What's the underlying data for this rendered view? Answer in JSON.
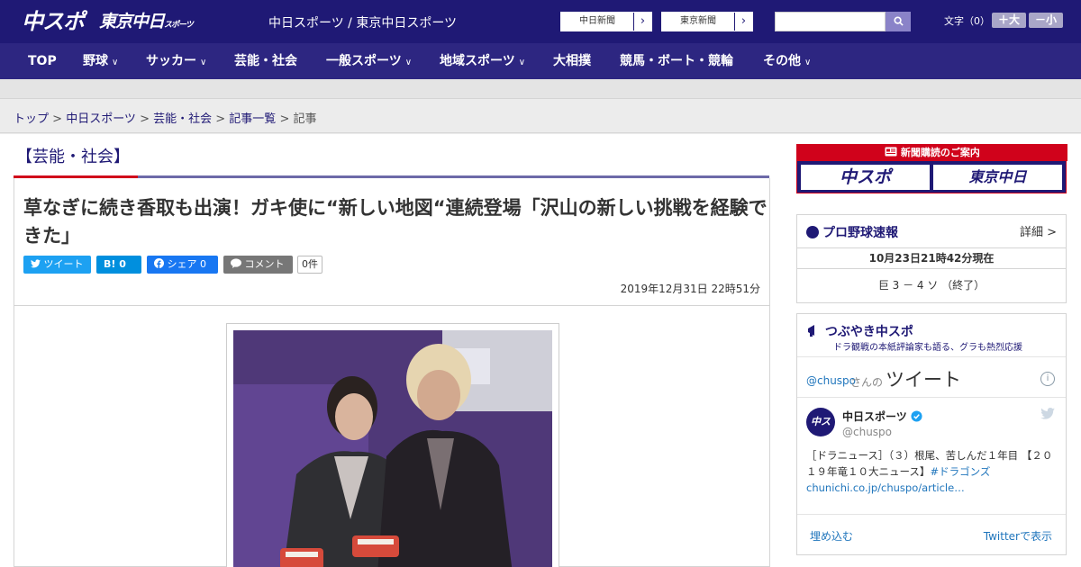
{
  "header": {
    "logo_chuspo": "中スポ",
    "logo_tokyo": "東京中日",
    "logo_tokyo_sub": "スポーツ",
    "site_title": "中日スポーツ / 東京中日スポーツ",
    "paper_links": [
      {
        "label": "中日新聞"
      },
      {
        "label": "東京新聞"
      }
    ],
    "search_placeholder": "",
    "font_size_label": "文字（0）",
    "font_plus": "＋大",
    "font_minus": "－小"
  },
  "nav": [
    {
      "label": "TOP",
      "has_menu": false
    },
    {
      "label": "野球",
      "has_menu": true
    },
    {
      "label": "サッカー",
      "has_menu": true
    },
    {
      "label": "芸能・社会",
      "has_menu": false
    },
    {
      "label": "一般スポーツ",
      "has_menu": true
    },
    {
      "label": "地域スポーツ",
      "has_menu": true
    },
    {
      "label": "大相撲",
      "has_menu": false
    },
    {
      "label": "競馬・ボート・競輪",
      "has_menu": false
    },
    {
      "label": "その他",
      "has_menu": true
    }
  ],
  "breadcrumb": {
    "items": [
      "トップ",
      "中日スポーツ",
      "芸能・社会",
      "記事一覧"
    ],
    "current": "記事"
  },
  "article": {
    "category": "【芸能・社会】",
    "headline": "草なぎに続き香取も出演！ガキ使に“新しい地図“連続登場「沢山の新しい挑戦を経験できた」",
    "share": {
      "tweet": "ツイート",
      "hatena": "B! 0",
      "facebook": "シェア 0",
      "comment": "コメント",
      "comment_count": "0件"
    },
    "date": "2019年12月31日 22時51分"
  },
  "sidebar": {
    "ad": {
      "title": "新聞購読のご案内",
      "chuspo": "中スポ",
      "tokyo": "東京中日"
    },
    "baseball": {
      "title": "プロ野球速報",
      "detail": "詳細 >",
      "timestamp": "10月23日21時42分現在",
      "score": "巨 3 － 4 ソ （終了）"
    },
    "tweet_panel": {
      "title": "つぶやき中スポ",
      "subtitle": "ドラ観戦の本紙評論家も語る、グラも熱烈応援",
      "account_prefix": "@chuspo",
      "account_suffix": "さんの",
      "tweets_label": "ツイート",
      "user_name": "中日スポーツ",
      "user_handle": "@chuspo",
      "tweet_text": "［ドラニュース］（３）根尾、苦しんだ１年目 【２０１９年竜１０大ニュース】",
      "tweet_hashtag": "#ドラゴンズ",
      "tweet_link": "chunichi.co.jp/chuspo/article…",
      "embed": "埋め込む",
      "view_on_twitter": "Twitterで表示"
    }
  },
  "colors": {
    "header_bg": "#1f1975",
    "nav_bg": "#2d2681",
    "accent_red": "#d0021b",
    "twitter_blue": "#1da1f2",
    "facebook_blue": "#1877f2",
    "hatena_blue": "#008fde"
  }
}
